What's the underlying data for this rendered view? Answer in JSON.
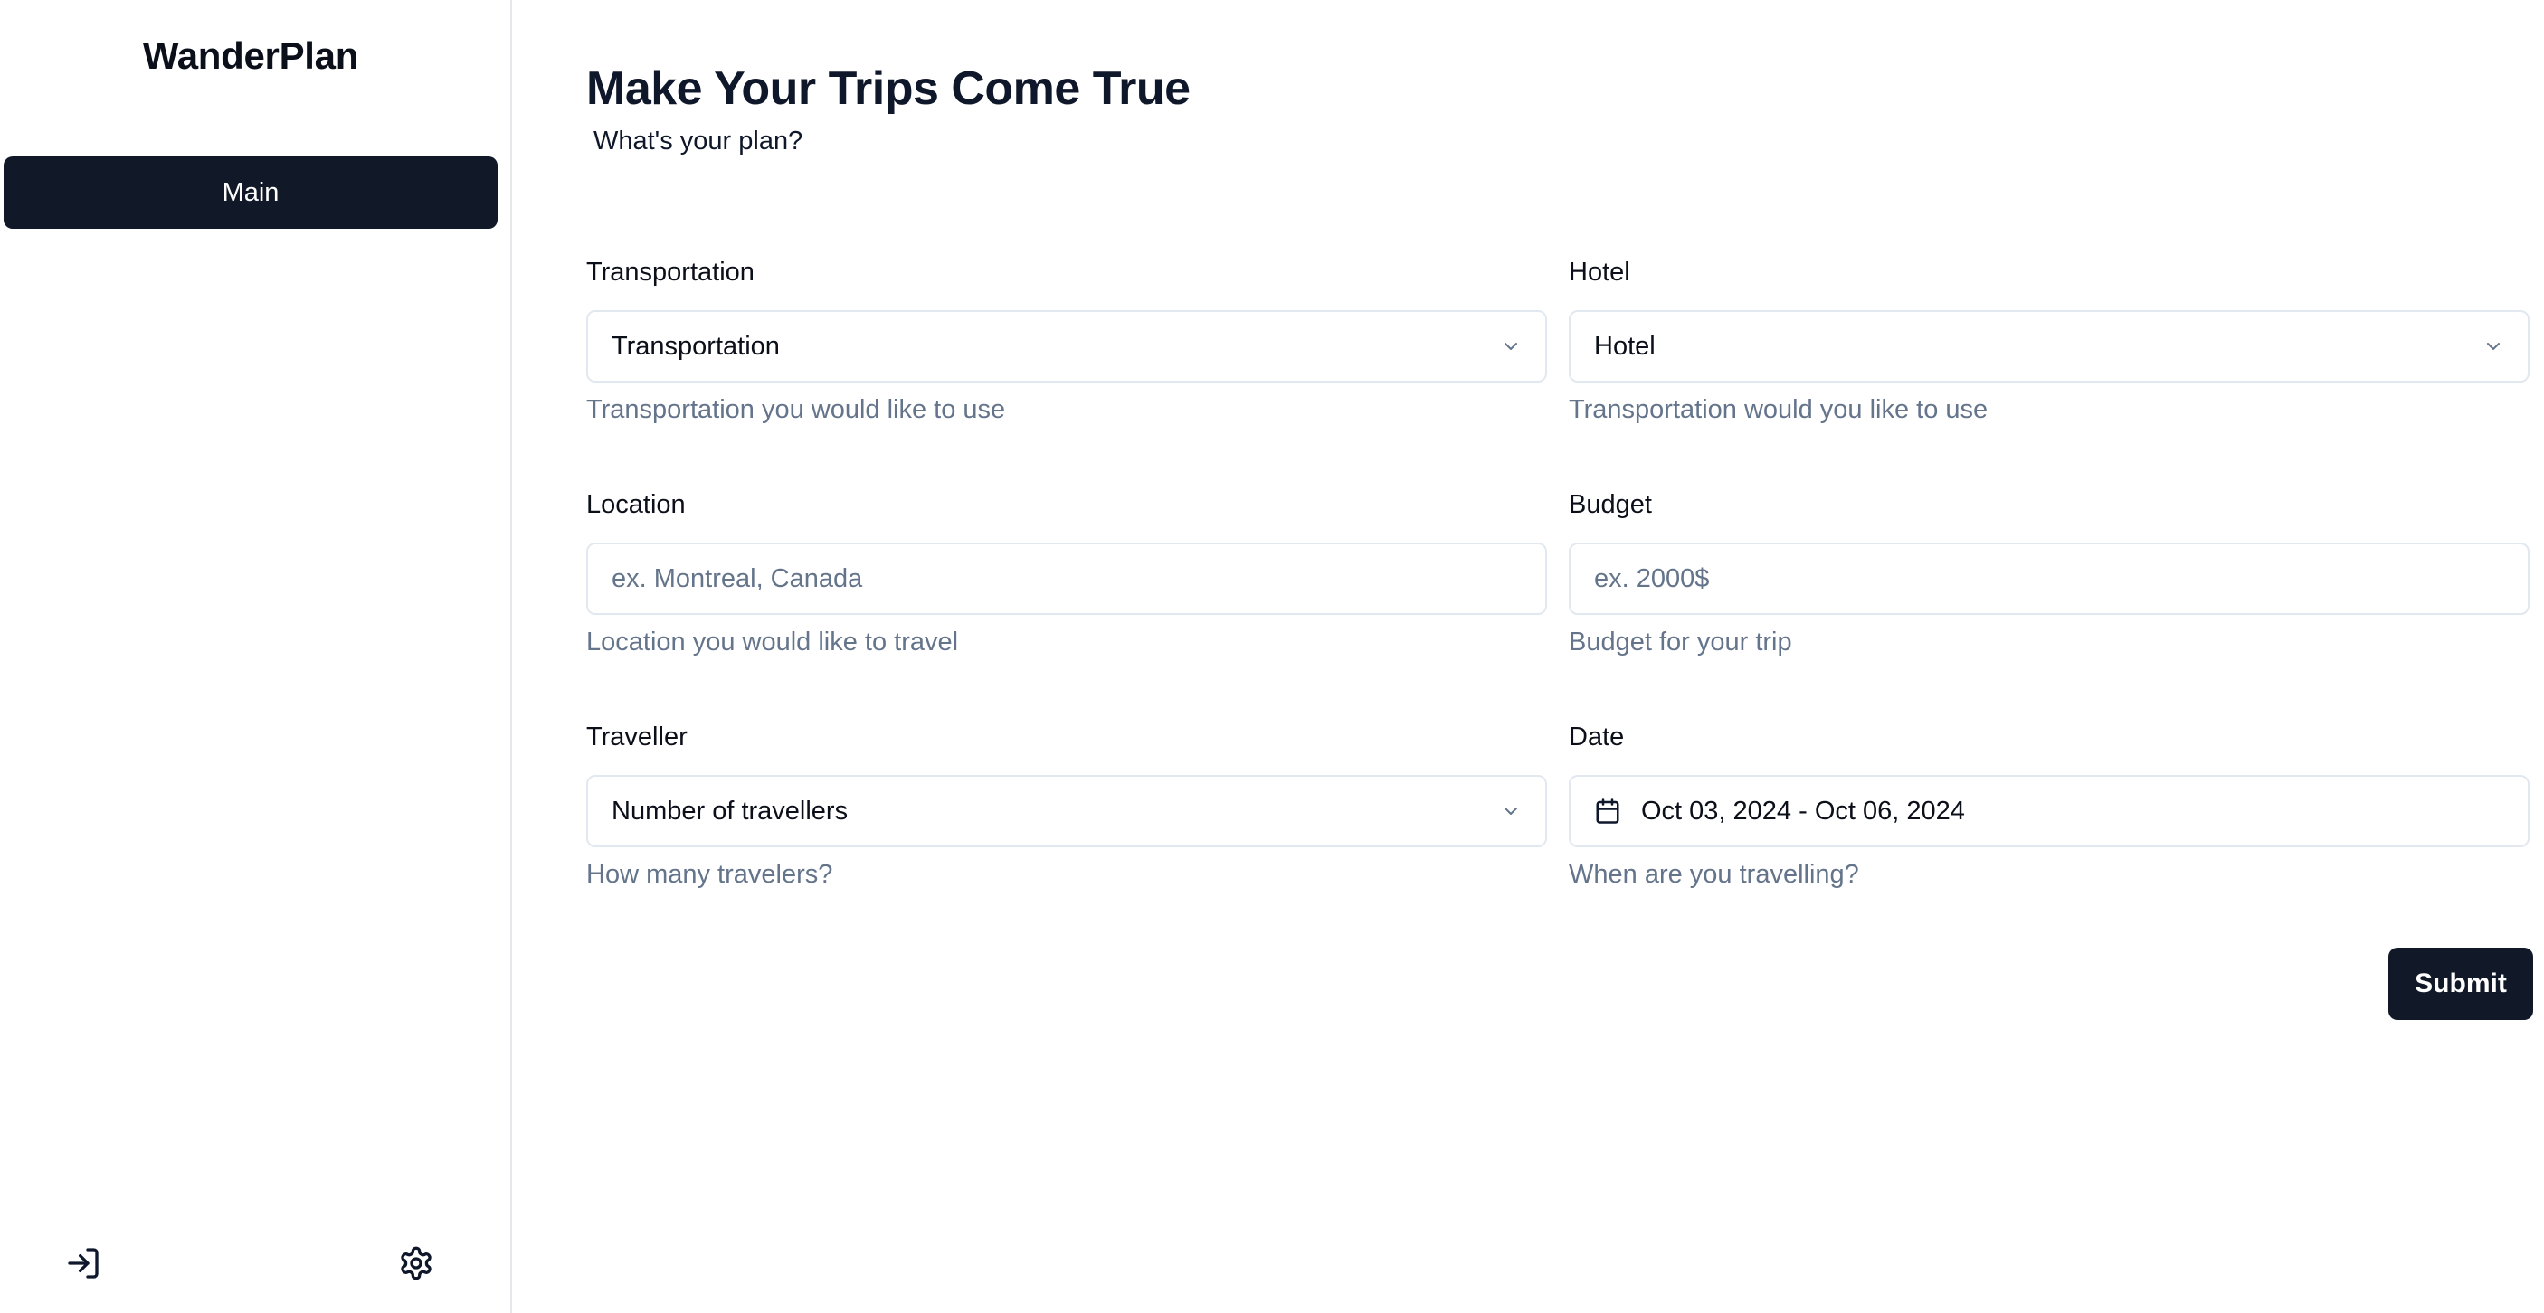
{
  "sidebar": {
    "brand": "WanderPlan",
    "nav_main_label": "Main",
    "bottom_icons": [
      "login-icon",
      "gear-icon"
    ]
  },
  "header": {
    "title": "Make Your Trips Come True",
    "subtitle": "What's your plan?"
  },
  "form": {
    "transportation": {
      "label": "Transportation",
      "selected": "Transportation",
      "help": "Transportation you would like to use"
    },
    "hotel": {
      "label": "Hotel",
      "selected": "Hotel",
      "help": "Transportation would you like to use"
    },
    "location": {
      "label": "Location",
      "placeholder": "ex. Montreal, Canada",
      "value": "",
      "help": "Location you would like to travel"
    },
    "budget": {
      "label": "Budget",
      "placeholder": "ex. 2000$",
      "value": "",
      "help": "Budget for your trip"
    },
    "traveller": {
      "label": "Traveller",
      "selected": "Number of travellers",
      "help": "How many travelers?"
    },
    "date": {
      "label": "Date",
      "value": "Oct 03, 2024 - Oct 06, 2024",
      "help": "When are you travelling?"
    },
    "submit_label": "Submit"
  },
  "colors": {
    "primary": "#111827",
    "muted_text": "#64748b",
    "border": "#e2e8f0"
  }
}
